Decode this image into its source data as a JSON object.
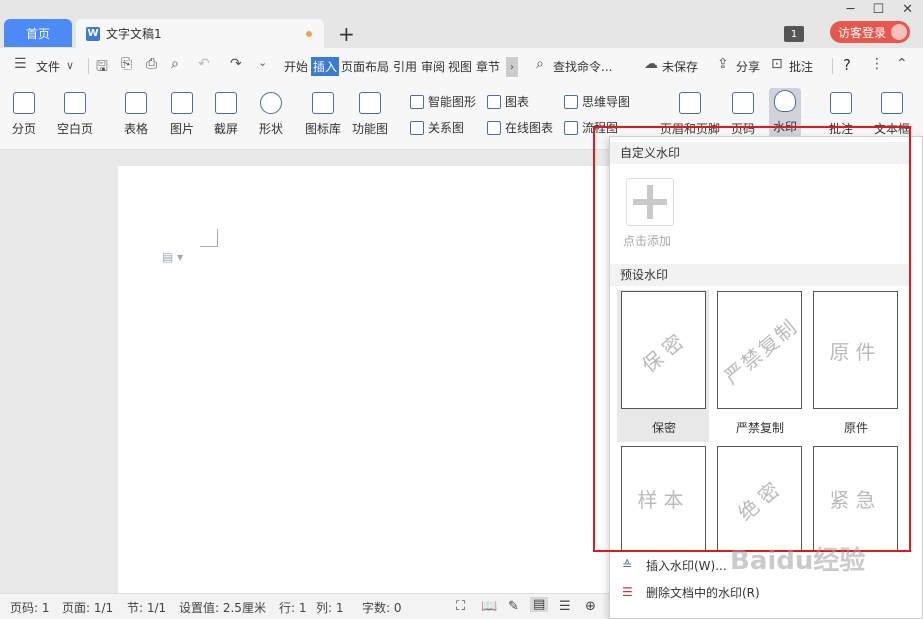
{
  "tabs": {
    "home": "首页",
    "doc": "文字文稿1",
    "badge": "1",
    "login": "访客登录"
  },
  "menu": {
    "file": "文件",
    "items": [
      "开始",
      "插入",
      "页面布局",
      "引用",
      "审阅",
      "视图",
      "章节"
    ],
    "active": "插入",
    "search": "查找命令...",
    "unsaved": "未保存",
    "share": "分享",
    "comment": "批注",
    "help": "?"
  },
  "ribbon": {
    "pagebreak": "分页",
    "blankpage": "空白页",
    "table": "表格",
    "picture": "图片",
    "screenshot": "截屏",
    "shape": "形状",
    "iconlib": "图标库",
    "funcchart": "功能图",
    "smartart": "智能图形",
    "chart": "图表",
    "mindmap": "思维导图",
    "relation": "关系图",
    "onlinechart": "在线图表",
    "flowchart": "流程图",
    "headerfooter": "页眉和页脚",
    "pagenum": "页码",
    "watermark": "水印",
    "annotate": "批注",
    "textbox": "文本框"
  },
  "dropdown": {
    "custom_header": "自定义水印",
    "add_label": "点击添加",
    "preset_header": "预设水印",
    "presets": [
      {
        "text": "保密",
        "label": "保密",
        "rotated": true
      },
      {
        "text": "严禁复制",
        "label": "严禁复制",
        "rotated": true
      },
      {
        "text": "原件",
        "label": "原件",
        "rotated": false
      },
      {
        "text": "样本",
        "rotated": false
      },
      {
        "text": "绝密",
        "rotated": true
      },
      {
        "text": "紧急",
        "rotated": false
      }
    ],
    "insert": "插入水印(W)...",
    "delete": "删除文档中的水印(R)"
  },
  "status": {
    "page": "页码: 1",
    "pages": "页面: 1/1",
    "section": "节: 1/1",
    "setting": "设置值: 2.5厘米",
    "row": "行: 1",
    "col": "列: 1",
    "words": "字数: 0"
  },
  "watermark_overlay": "Baidu经验",
  "colors": {
    "accent": "#3a7bd5",
    "highlight_box": "#e0191e",
    "login": "#e8574d"
  }
}
